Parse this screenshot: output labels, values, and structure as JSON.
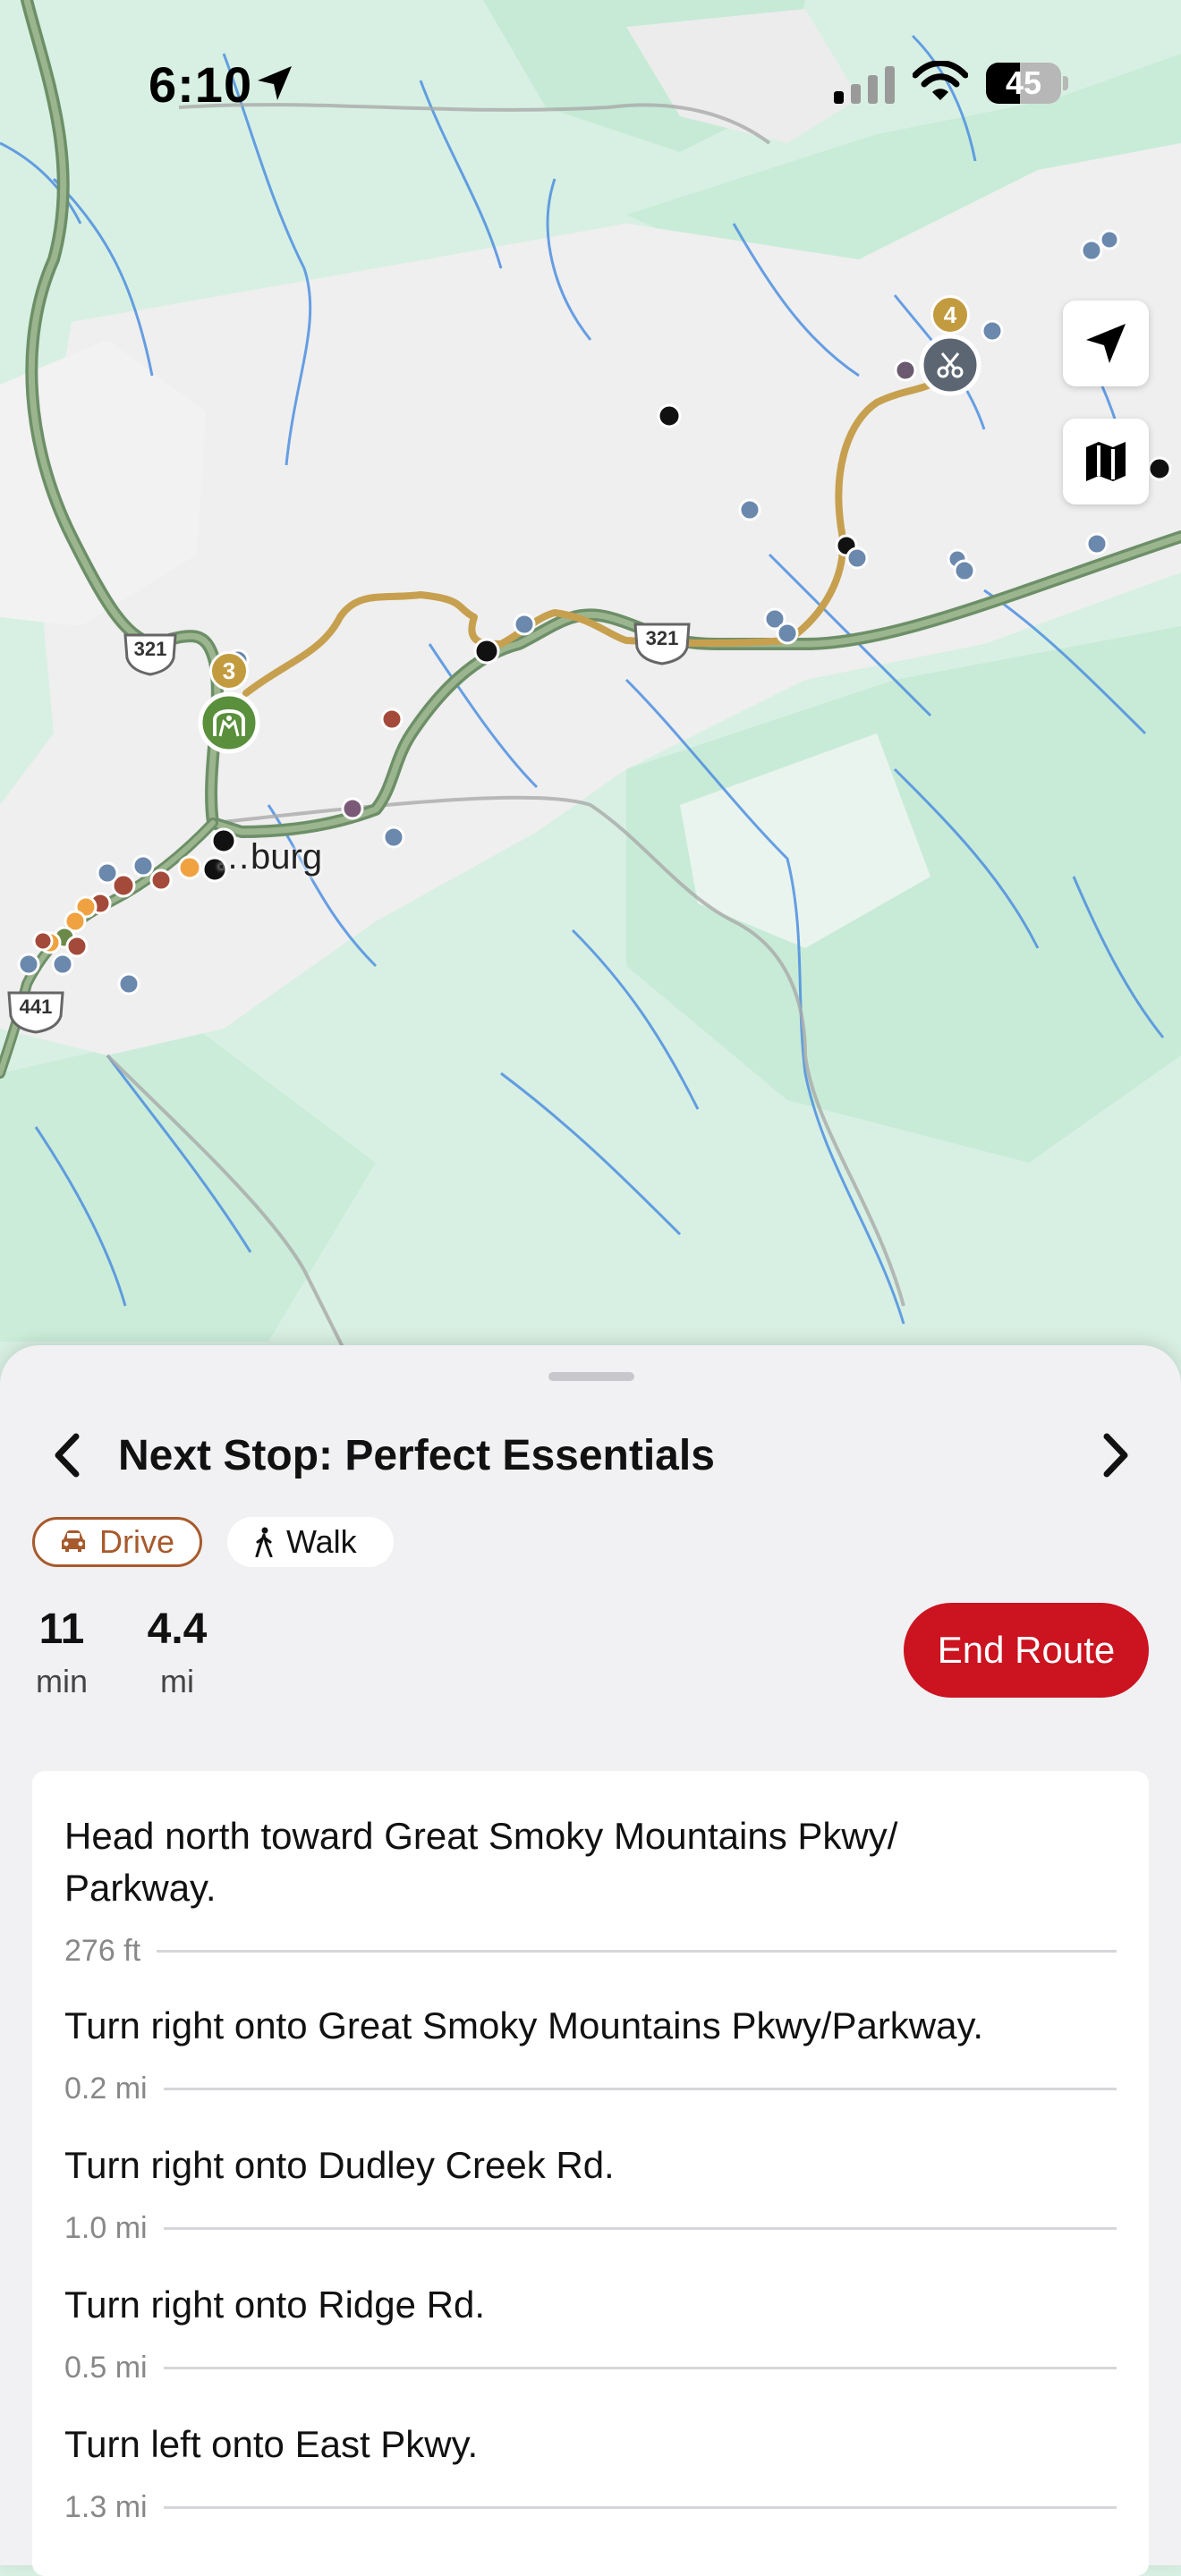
{
  "status_bar": {
    "time": "6:10",
    "battery": "45",
    "battery_level": 0.45,
    "icons": [
      "location-arrow-icon",
      "cellular-signal-icon",
      "wifi-icon",
      "battery-icon"
    ]
  },
  "map": {
    "route_badges": [
      "3",
      "4"
    ],
    "highway_shields": [
      "321",
      "321",
      "441"
    ],
    "place_label": "…burg",
    "colors": {
      "land": "#d8f0e3",
      "urban": "#f2f2f2",
      "water": "#4d8fe0",
      "highway": "#7a9a76",
      "route": "#c7a04f"
    },
    "controls": [
      "navigation-arrow-icon",
      "map-icon"
    ]
  },
  "sheet": {
    "title": "Next Stop: Perfect Essentials",
    "modes": {
      "drive": "Drive",
      "walk": "Walk",
      "selected": "drive"
    },
    "stats": {
      "time_value": "11",
      "time_unit": "min",
      "distance_value": "4.4",
      "distance_unit": "mi"
    },
    "end_route": "End Route",
    "directions": [
      {
        "instruction": "Head north toward Great Smoky Mountains Pkwy/ Parkway.",
        "distance": "276 ft"
      },
      {
        "instruction": "Turn right onto Great Smoky Mountains Pkwy/Parkway.",
        "distance": "0.2 mi"
      },
      {
        "instruction": "Turn right onto Dudley Creek Rd.",
        "distance": "1.0 mi"
      },
      {
        "instruction": "Turn right onto Ridge Rd.",
        "distance": "0.5 mi"
      },
      {
        "instruction": "Turn left onto East Pkwy.",
        "distance": "1.3 mi"
      }
    ],
    "colors": {
      "accent_red": "#cc1320",
      "drive_brown": "#a75a2c"
    }
  }
}
